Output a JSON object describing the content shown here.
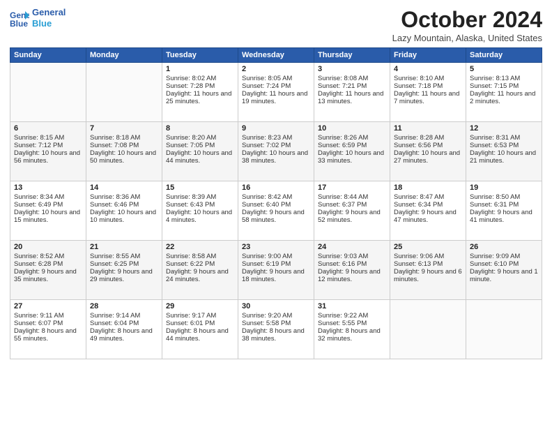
{
  "header": {
    "logo_line1": "General",
    "logo_line2": "Blue",
    "title": "October 2024",
    "location": "Lazy Mountain, Alaska, United States"
  },
  "weekdays": [
    "Sunday",
    "Monday",
    "Tuesday",
    "Wednesday",
    "Thursday",
    "Friday",
    "Saturday"
  ],
  "weeks": [
    [
      {
        "day": "",
        "info": ""
      },
      {
        "day": "",
        "info": ""
      },
      {
        "day": "1",
        "info": "Sunrise: 8:02 AM\nSunset: 7:28 PM\nDaylight: 11 hours and 25 minutes."
      },
      {
        "day": "2",
        "info": "Sunrise: 8:05 AM\nSunset: 7:24 PM\nDaylight: 11 hours and 19 minutes."
      },
      {
        "day": "3",
        "info": "Sunrise: 8:08 AM\nSunset: 7:21 PM\nDaylight: 11 hours and 13 minutes."
      },
      {
        "day": "4",
        "info": "Sunrise: 8:10 AM\nSunset: 7:18 PM\nDaylight: 11 hours and 7 minutes."
      },
      {
        "day": "5",
        "info": "Sunrise: 8:13 AM\nSunset: 7:15 PM\nDaylight: 11 hours and 2 minutes."
      }
    ],
    [
      {
        "day": "6",
        "info": "Sunrise: 8:15 AM\nSunset: 7:12 PM\nDaylight: 10 hours and 56 minutes."
      },
      {
        "day": "7",
        "info": "Sunrise: 8:18 AM\nSunset: 7:08 PM\nDaylight: 10 hours and 50 minutes."
      },
      {
        "day": "8",
        "info": "Sunrise: 8:20 AM\nSunset: 7:05 PM\nDaylight: 10 hours and 44 minutes."
      },
      {
        "day": "9",
        "info": "Sunrise: 8:23 AM\nSunset: 7:02 PM\nDaylight: 10 hours and 38 minutes."
      },
      {
        "day": "10",
        "info": "Sunrise: 8:26 AM\nSunset: 6:59 PM\nDaylight: 10 hours and 33 minutes."
      },
      {
        "day": "11",
        "info": "Sunrise: 8:28 AM\nSunset: 6:56 PM\nDaylight: 10 hours and 27 minutes."
      },
      {
        "day": "12",
        "info": "Sunrise: 8:31 AM\nSunset: 6:53 PM\nDaylight: 10 hours and 21 minutes."
      }
    ],
    [
      {
        "day": "13",
        "info": "Sunrise: 8:34 AM\nSunset: 6:49 PM\nDaylight: 10 hours and 15 minutes."
      },
      {
        "day": "14",
        "info": "Sunrise: 8:36 AM\nSunset: 6:46 PM\nDaylight: 10 hours and 10 minutes."
      },
      {
        "day": "15",
        "info": "Sunrise: 8:39 AM\nSunset: 6:43 PM\nDaylight: 10 hours and 4 minutes."
      },
      {
        "day": "16",
        "info": "Sunrise: 8:42 AM\nSunset: 6:40 PM\nDaylight: 9 hours and 58 minutes."
      },
      {
        "day": "17",
        "info": "Sunrise: 8:44 AM\nSunset: 6:37 PM\nDaylight: 9 hours and 52 minutes."
      },
      {
        "day": "18",
        "info": "Sunrise: 8:47 AM\nSunset: 6:34 PM\nDaylight: 9 hours and 47 minutes."
      },
      {
        "day": "19",
        "info": "Sunrise: 8:50 AM\nSunset: 6:31 PM\nDaylight: 9 hours and 41 minutes."
      }
    ],
    [
      {
        "day": "20",
        "info": "Sunrise: 8:52 AM\nSunset: 6:28 PM\nDaylight: 9 hours and 35 minutes."
      },
      {
        "day": "21",
        "info": "Sunrise: 8:55 AM\nSunset: 6:25 PM\nDaylight: 9 hours and 29 minutes."
      },
      {
        "day": "22",
        "info": "Sunrise: 8:58 AM\nSunset: 6:22 PM\nDaylight: 9 hours and 24 minutes."
      },
      {
        "day": "23",
        "info": "Sunrise: 9:00 AM\nSunset: 6:19 PM\nDaylight: 9 hours and 18 minutes."
      },
      {
        "day": "24",
        "info": "Sunrise: 9:03 AM\nSunset: 6:16 PM\nDaylight: 9 hours and 12 minutes."
      },
      {
        "day": "25",
        "info": "Sunrise: 9:06 AM\nSunset: 6:13 PM\nDaylight: 9 hours and 6 minutes."
      },
      {
        "day": "26",
        "info": "Sunrise: 9:09 AM\nSunset: 6:10 PM\nDaylight: 9 hours and 1 minute."
      }
    ],
    [
      {
        "day": "27",
        "info": "Sunrise: 9:11 AM\nSunset: 6:07 PM\nDaylight: 8 hours and 55 minutes."
      },
      {
        "day": "28",
        "info": "Sunrise: 9:14 AM\nSunset: 6:04 PM\nDaylight: 8 hours and 49 minutes."
      },
      {
        "day": "29",
        "info": "Sunrise: 9:17 AM\nSunset: 6:01 PM\nDaylight: 8 hours and 44 minutes."
      },
      {
        "day": "30",
        "info": "Sunrise: 9:20 AM\nSunset: 5:58 PM\nDaylight: 8 hours and 38 minutes."
      },
      {
        "day": "31",
        "info": "Sunrise: 9:22 AM\nSunset: 5:55 PM\nDaylight: 8 hours and 32 minutes."
      },
      {
        "day": "",
        "info": ""
      },
      {
        "day": "",
        "info": ""
      }
    ]
  ]
}
